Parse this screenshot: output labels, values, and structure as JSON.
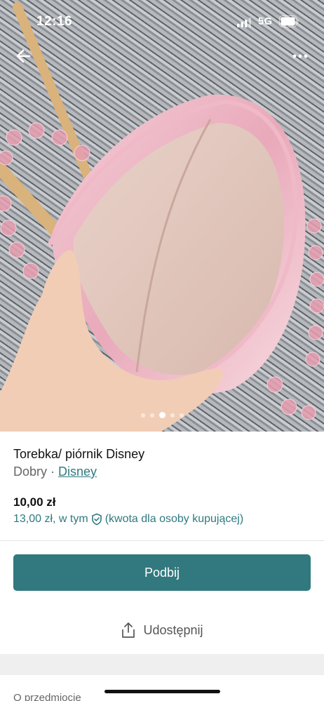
{
  "status_bar": {
    "time": "12:16",
    "network": "5G"
  },
  "photo": {
    "description_icon": "item-photo",
    "pager": {
      "count": 5,
      "active_index": 2
    }
  },
  "listing": {
    "title": "Torebka/ piórnik Disney",
    "condition": "Dobry",
    "separator": "·",
    "brand": "Disney",
    "price": "10,00 zł",
    "total_prefix": "13,00 zł, w tym",
    "total_suffix": "(kwota dla osoby kupującej)"
  },
  "actions": {
    "bump_label": "Podbij",
    "share_label": "Udostępnij"
  },
  "section": {
    "heading": "O przedmiocie"
  },
  "colors": {
    "accent": "#31797f",
    "link": "#2f7a80"
  }
}
